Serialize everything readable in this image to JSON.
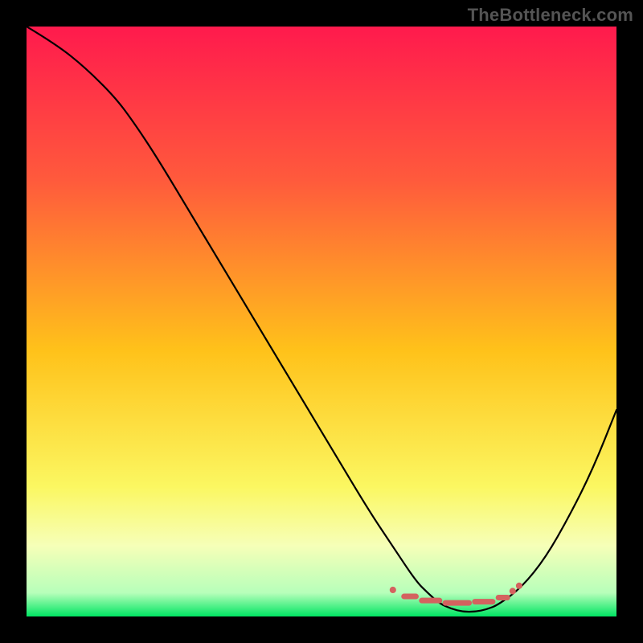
{
  "branding": {
    "watermark": "TheBottleneck.com"
  },
  "chart_data": {
    "type": "line",
    "title": "",
    "xlabel": "",
    "ylabel": "",
    "xlim": [
      0,
      100
    ],
    "ylim": [
      0,
      100
    ],
    "background_gradient": {
      "stops": [
        {
          "offset": 0.0,
          "color": "#ff1a4d"
        },
        {
          "offset": 0.26,
          "color": "#ff5a3c"
        },
        {
          "offset": 0.55,
          "color": "#ffc21a"
        },
        {
          "offset": 0.78,
          "color": "#fbf761"
        },
        {
          "offset": 0.88,
          "color": "#f6ffb8"
        },
        {
          "offset": 0.96,
          "color": "#b7ffba"
        },
        {
          "offset": 1.0,
          "color": "#00e562"
        }
      ]
    },
    "series": [
      {
        "name": "bottleneck-curve",
        "description": "V-shaped curve; y is bottleneck percentage-like metric (100 top, 0 bottom). Minimum near x≈75.",
        "x": [
          0,
          5,
          10,
          15,
          18,
          22,
          28,
          34,
          40,
          46,
          52,
          58,
          62,
          66,
          68,
          70,
          72,
          74,
          76,
          78,
          80,
          84,
          88,
          92,
          96,
          100
        ],
        "values": [
          100,
          97,
          93,
          88,
          84,
          78,
          68,
          58,
          48,
          38,
          28,
          18,
          12,
          6,
          4,
          2.2,
          1.3,
          0.8,
          0.8,
          1.2,
          2,
          5,
          10,
          17,
          25,
          35
        ]
      }
    ],
    "markers": {
      "name": "optimal-range",
      "style": "dashed-dots",
      "color": "#d4625f",
      "segments": [
        {
          "x0": 62.0,
          "x1": 62.2,
          "y": 4.5
        },
        {
          "x0": 64.0,
          "x1": 66.0,
          "y": 3.4
        },
        {
          "x0": 67.0,
          "x1": 70.0,
          "y": 2.7
        },
        {
          "x0": 71.0,
          "x1": 75.0,
          "y": 2.3
        },
        {
          "x0": 76.0,
          "x1": 79.0,
          "y": 2.5
        },
        {
          "x0": 80.0,
          "x1": 81.5,
          "y": 3.2
        },
        {
          "x0": 82.3,
          "x1": 82.5,
          "y": 4.3
        },
        {
          "x0": 83.4,
          "x1": 83.6,
          "y": 5.2
        }
      ]
    }
  }
}
